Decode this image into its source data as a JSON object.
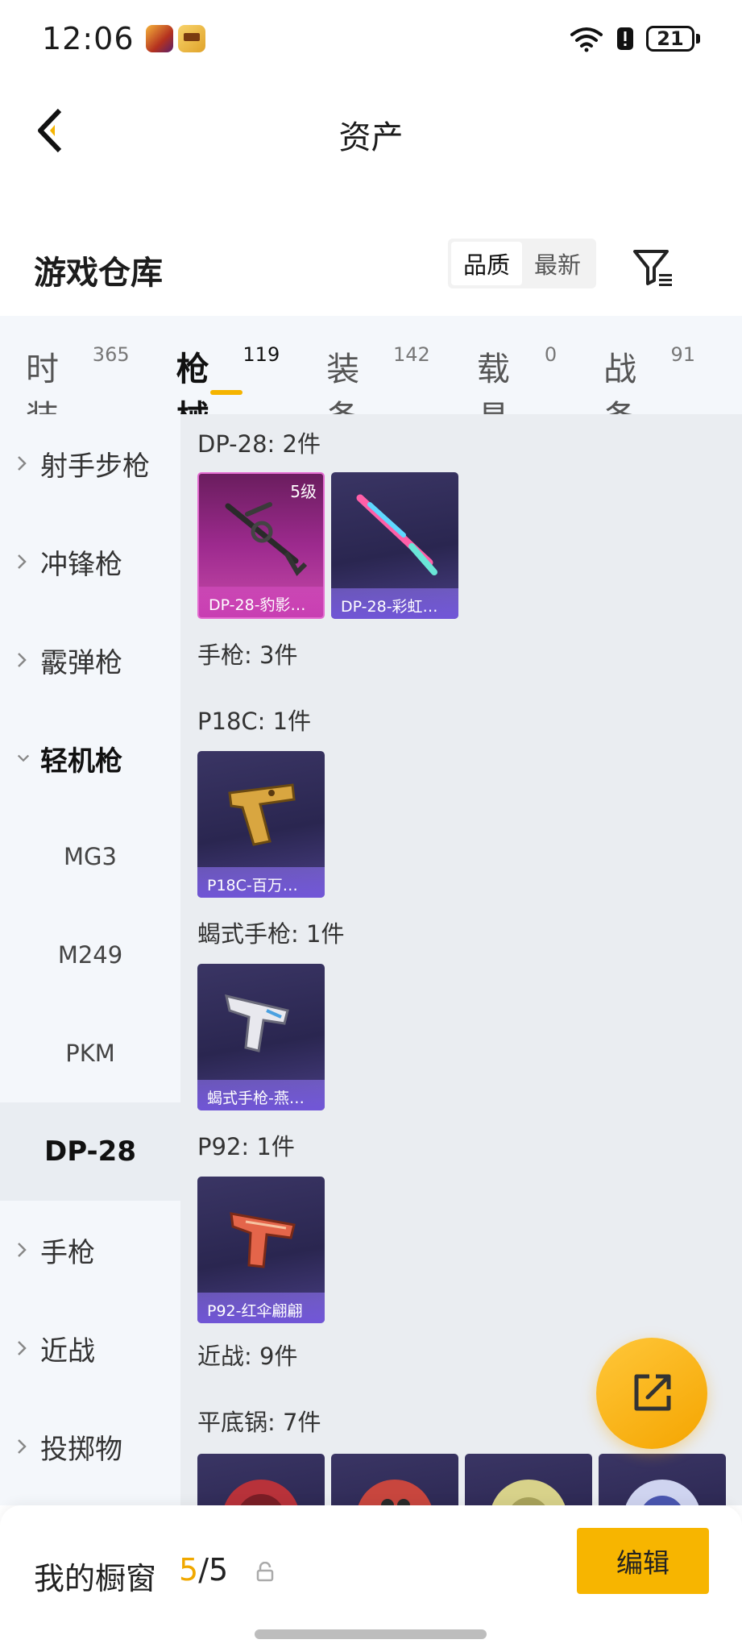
{
  "status_bar": {
    "time": "12:06",
    "battery": "21"
  },
  "header": {
    "title": "资产"
  },
  "section": {
    "title": "游戏仓库",
    "sort_options": [
      "品质",
      "最新"
    ],
    "active_sort": "品质"
  },
  "tabs": [
    {
      "label": "时装",
      "count": "365"
    },
    {
      "label": "枪械",
      "count": "119"
    },
    {
      "label": "装备",
      "count": "142"
    },
    {
      "label": "载具",
      "count": "0"
    },
    {
      "label": "战备",
      "count": "91"
    }
  ],
  "sidebar": {
    "items": [
      {
        "label": "射手步枪"
      },
      {
        "label": "冲锋枪"
      },
      {
        "label": "霰弹枪"
      },
      {
        "label": "轻机枪"
      },
      {
        "label": "手枪"
      },
      {
        "label": "近战"
      },
      {
        "label": "投掷物"
      }
    ],
    "sub_items": [
      {
        "label": "MG3"
      },
      {
        "label": "M249"
      },
      {
        "label": "PKM"
      },
      {
        "label": "DP-28"
      }
    ]
  },
  "content": {
    "groups": [
      {
        "label": "DP-28: 2件"
      },
      {
        "label": "手枪: 3件"
      },
      {
        "label": "P18C: 1件"
      },
      {
        "label": "蝎式手枪: 1件"
      },
      {
        "label": "P92: 1件"
      },
      {
        "label": "近战: 9件"
      },
      {
        "label": "平底锅: 7件"
      }
    ],
    "items": [
      {
        "name": "DP-28-豹影…",
        "level": "5级",
        "rarity": "legendary"
      },
      {
        "name": "DP-28-彩虹…",
        "rarity": "epic"
      },
      {
        "name": "P18C-百万…",
        "rarity": "epic"
      },
      {
        "name": "蝎式手枪-燕…",
        "rarity": "epic"
      },
      {
        "name": "P92-红伞翩翩",
        "rarity": "epic"
      }
    ]
  },
  "bottom_bar": {
    "window_label": "我的橱窗",
    "current": "5",
    "separator": "/",
    "total": "5",
    "edit_label": "编辑"
  },
  "colors": {
    "accent": "#f7b500",
    "sidebar_bg": "#f4f7fb",
    "content_bg": "#eaedf1"
  }
}
